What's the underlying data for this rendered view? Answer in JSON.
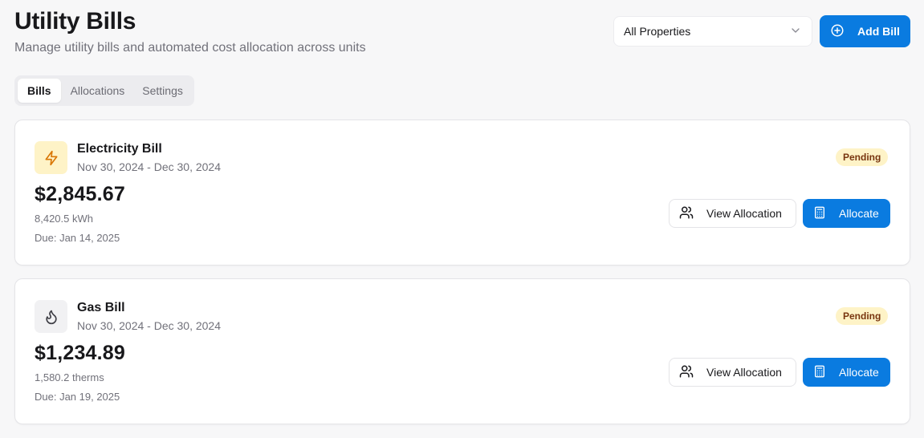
{
  "header": {
    "title": "Utility Bills",
    "subtitle": "Manage utility bills and automated cost allocation across units"
  },
  "property_filter": {
    "selected": "All Properties",
    "icon": "chevron-down-icon"
  },
  "add_bill": {
    "label": "Add Bill",
    "icon": "plus-circle-icon"
  },
  "tabs": [
    {
      "label": "Bills",
      "active": true
    },
    {
      "label": "Allocations",
      "active": false
    },
    {
      "label": "Settings",
      "active": false
    }
  ],
  "bills": [
    {
      "name": "Electricity Bill",
      "period": "Nov 30, 2024 - Dec 30, 2024",
      "amount": "$2,845.67",
      "usage": "8,420.5 kWh",
      "due": "Due: Jan 14, 2025",
      "status": "Pending",
      "icon": "lightning-bolt-icon",
      "view_label": "View Allocation",
      "allocate_label": "Allocate"
    },
    {
      "name": "Gas Bill",
      "period": "Nov 30, 2024 - Dec 30, 2024",
      "amount": "$1,234.89",
      "usage": "1,580.2 therms",
      "due": "Due: Jan 19, 2025",
      "status": "Pending",
      "icon": "flame-icon",
      "view_label": "View Allocation",
      "allocate_label": "Allocate"
    }
  ],
  "colors": {
    "primary": "#0a7be0",
    "pending_bg": "#fef3c7",
    "pending_text": "#78350f",
    "electric_icon": "#d97706"
  }
}
